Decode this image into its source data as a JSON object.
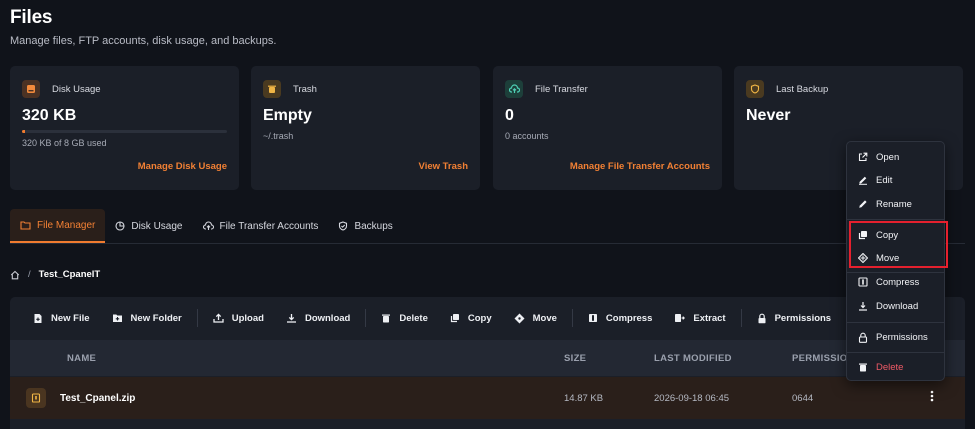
{
  "page": {
    "title": "Files",
    "subtitle": "Manage files, FTP accounts, disk usage, and backups."
  },
  "cards": [
    {
      "label": "Disk Usage",
      "value": "320 KB",
      "sub": "320 KB of 8 GB used",
      "progress": 0.004,
      "link": "Manage Disk Usage"
    },
    {
      "label": "Trash",
      "value": "Empty",
      "sub": "~/.trash",
      "link": "View Trash"
    },
    {
      "label": "File Transfer",
      "value": "0",
      "sub": "0 accounts",
      "link": "Manage File Transfer Accounts"
    },
    {
      "label": "Last Backup",
      "value": "Never"
    }
  ],
  "tabs": [
    {
      "label": "File Manager",
      "active": true
    },
    {
      "label": "Disk Usage"
    },
    {
      "label": "File Transfer Accounts"
    },
    {
      "label": "Backups"
    }
  ],
  "breadcrumb": {
    "separator": "/",
    "current": "Test_CpanelT"
  },
  "toolbar": {
    "new_file": "New File",
    "new_folder": "New Folder",
    "upload": "Upload",
    "download": "Download",
    "delete": "Delete",
    "copy": "Copy",
    "move": "Move",
    "compress": "Compress",
    "extract": "Extract",
    "permissions": "Permissions"
  },
  "table": {
    "columns": [
      "NAME",
      "SIZE",
      "LAST MODIFIED",
      "PERMISSIONS"
    ],
    "rows": [
      {
        "name": "Test_Cpanel.zip",
        "size": "14.87 KB",
        "modified": "2026-09-18 06:45",
        "permissions": "0644"
      }
    ]
  },
  "context_menu": {
    "open": "Open",
    "edit": "Edit",
    "rename": "Rename",
    "copy": "Copy",
    "move": "Move",
    "compress": "Compress",
    "download": "Download",
    "permissions": "Permissions",
    "delete": "Delete"
  },
  "colors": {
    "accent": "#f07b2f",
    "background": "#10131a",
    "card": "#1b1f28",
    "danger": "#ef5a66",
    "highlight": "#e5202e"
  }
}
